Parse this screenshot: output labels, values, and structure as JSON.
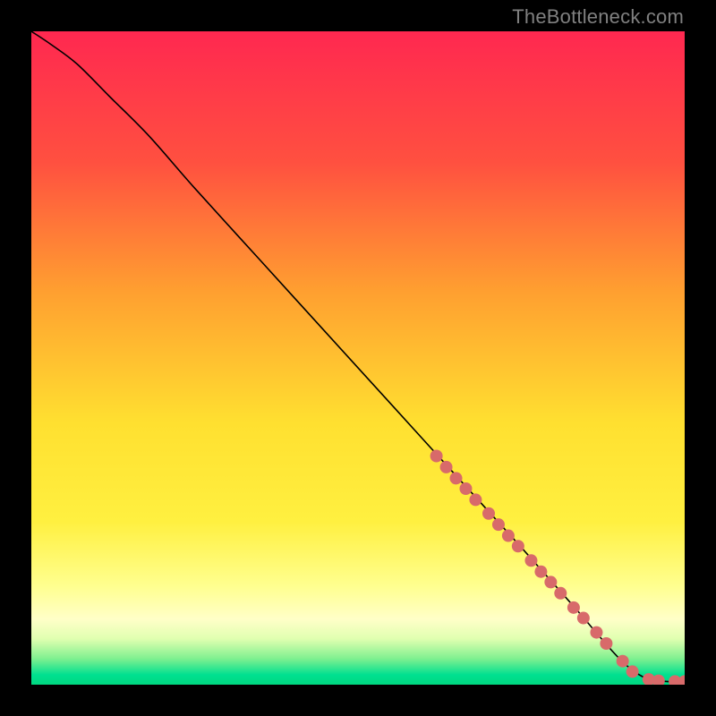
{
  "watermark": "TheBottleneck.com",
  "chart_data": {
    "type": "line",
    "title": "",
    "xlabel": "",
    "ylabel": "",
    "xlim": [
      0,
      100
    ],
    "ylim": [
      0,
      100
    ],
    "background_gradient": {
      "stops": [
        {
          "pct": 0,
          "color": "#ff2850"
        },
        {
          "pct": 20,
          "color": "#ff5040"
        },
        {
          "pct": 40,
          "color": "#ffa030"
        },
        {
          "pct": 60,
          "color": "#ffe030"
        },
        {
          "pct": 75,
          "color": "#fff040"
        },
        {
          "pct": 85,
          "color": "#ffff90"
        },
        {
          "pct": 90,
          "color": "#ffffc8"
        },
        {
          "pct": 93,
          "color": "#e0ffb0"
        },
        {
          "pct": 96,
          "color": "#80f090"
        },
        {
          "pct": 98.5,
          "color": "#00e090"
        },
        {
          "pct": 100,
          "color": "#00d880"
        }
      ]
    },
    "series": [
      {
        "name": "bottleneck-curve",
        "color": "#000000",
        "stroke_width": 1.6,
        "x": [
          0,
          3,
          7,
          12,
          18,
          25,
          35,
          45,
          55,
          65,
          75,
          83,
          90,
          94,
          97,
          100
        ],
        "y": [
          100,
          98,
          95,
          90,
          84,
          76,
          65,
          54,
          43,
          32,
          21,
          12,
          4,
          1,
          0.5,
          0.5
        ]
      }
    ],
    "markers": {
      "name": "highlighted-points",
      "color": "#d86a6a",
      "radius": 7,
      "points": [
        {
          "x": 62,
          "y": 35
        },
        {
          "x": 63.5,
          "y": 33.3
        },
        {
          "x": 65,
          "y": 31.6
        },
        {
          "x": 66.5,
          "y": 30
        },
        {
          "x": 68,
          "y": 28.3
        },
        {
          "x": 70,
          "y": 26.2
        },
        {
          "x": 71.5,
          "y": 24.5
        },
        {
          "x": 73,
          "y": 22.8
        },
        {
          "x": 74.5,
          "y": 21.2
        },
        {
          "x": 76.5,
          "y": 19
        },
        {
          "x": 78,
          "y": 17.3
        },
        {
          "x": 79.5,
          "y": 15.7
        },
        {
          "x": 81,
          "y": 14
        },
        {
          "x": 83,
          "y": 11.8
        },
        {
          "x": 84.5,
          "y": 10.2
        },
        {
          "x": 86.5,
          "y": 8
        },
        {
          "x": 88,
          "y": 6.3
        },
        {
          "x": 90.5,
          "y": 3.6
        },
        {
          "x": 92,
          "y": 2
        },
        {
          "x": 94.5,
          "y": 0.8
        },
        {
          "x": 96,
          "y": 0.6
        },
        {
          "x": 98.5,
          "y": 0.5
        },
        {
          "x": 100,
          "y": 0.5
        }
      ]
    }
  }
}
